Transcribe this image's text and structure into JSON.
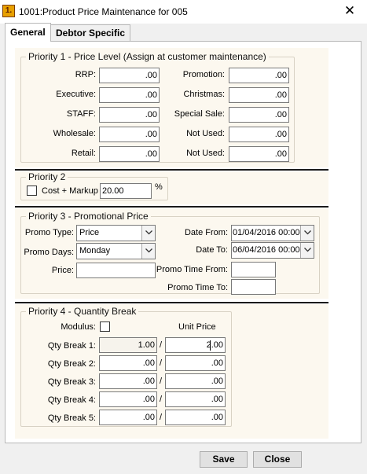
{
  "window": {
    "icon_text": "1.",
    "title": "1001:Product Price Maintenance for 005"
  },
  "tabs": [
    {
      "label": "General",
      "active": true
    },
    {
      "label": "Debtor Specific",
      "active": false
    }
  ],
  "priority1": {
    "legend": "Priority 1 - Price Level (Assign at customer maintenance)",
    "left": [
      {
        "label": "RRP:",
        "value": ".00"
      },
      {
        "label": "Executive:",
        "value": ".00"
      },
      {
        "label": "STAFF:",
        "value": ".00"
      },
      {
        "label": "Wholesale:",
        "value": ".00"
      },
      {
        "label": "Retail:",
        "value": ".00"
      }
    ],
    "right": [
      {
        "label": "Promotion:",
        "value": ".00"
      },
      {
        "label": "Christmas:",
        "value": ".00"
      },
      {
        "label": "Special Sale:",
        "value": ".00"
      },
      {
        "label": "Not Used:",
        "value": ".00"
      },
      {
        "label": "Not Used:",
        "value": ".00"
      }
    ]
  },
  "priority2": {
    "legend": "Priority 2",
    "checkbox_label": "Cost + Markup",
    "checked": false,
    "markup_value": "20.00",
    "unit": "%"
  },
  "priority3": {
    "legend": "Priority 3 - Promotional Price",
    "promo_type_label": "Promo Type:",
    "promo_type_value": "Price",
    "promo_days_label": "Promo Days:",
    "promo_days_value": "Monday",
    "price_label": "Price:",
    "price_value": "",
    "date_from_label": "Date From:",
    "date_from_value": "01/04/2016 00:00",
    "date_to_label": "Date To:",
    "date_to_value": "06/04/2016 00:00",
    "time_from_label": "Promo Time From:",
    "time_from_value": "",
    "time_to_label": "Promo Time To:",
    "time_to_value": ""
  },
  "priority4": {
    "legend": "Priority 4 - Quantity Break",
    "modulus_label": "Modulus:",
    "modulus_checked": false,
    "unit_price_header": "Unit Price",
    "separator": "/",
    "rows": [
      {
        "label": "Qty Break 1:",
        "qty": "1.00",
        "price": "2.00"
      },
      {
        "label": "Qty Break 2:",
        "qty": ".00",
        "price": ".00"
      },
      {
        "label": "Qty Break 3:",
        "qty": ".00",
        "price": ".00"
      },
      {
        "label": "Qty Break 4:",
        "qty": ".00",
        "price": ".00"
      },
      {
        "label": "Qty Break 5:",
        "qty": ".00",
        "price": ".00"
      }
    ]
  },
  "buttons": {
    "save": "Save",
    "close": "Close"
  },
  "icons": {
    "app": "app-icon",
    "close": "close-icon",
    "dropdown": "chevron-down-icon"
  }
}
